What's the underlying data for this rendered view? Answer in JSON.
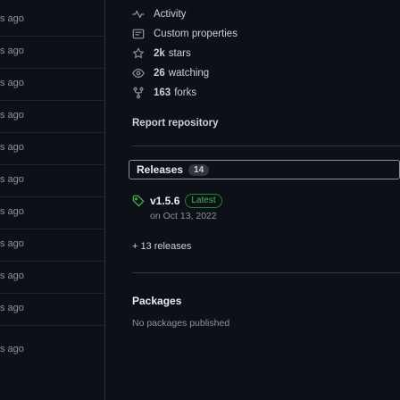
{
  "commit_ages": [
    "s ago",
    "s ago",
    "s ago",
    "s ago",
    "s ago",
    "s ago",
    "s ago",
    "s ago",
    "s ago",
    "s ago",
    "s ago"
  ],
  "about": {
    "activity": "Activity",
    "custom_properties": "Custom properties",
    "stars_count": "2k",
    "stars_label": "stars",
    "watching_count": "26",
    "watching_label": "watching",
    "forks_count": "163",
    "forks_label": "forks",
    "report": "Report repository"
  },
  "releases": {
    "title": "Releases",
    "count": "14",
    "latest_version": "v1.5.6",
    "latest_badge": "Latest",
    "latest_date": "on Oct 13, 2022",
    "more": "+ 13 releases"
  },
  "packages": {
    "title": "Packages",
    "empty": "No packages published"
  },
  "icons": {
    "activity": "pulse-icon",
    "custom_properties": "note-icon",
    "stars": "star-icon",
    "watching": "eye-icon",
    "forks": "repo-forked-icon",
    "release": "tag-icon"
  }
}
